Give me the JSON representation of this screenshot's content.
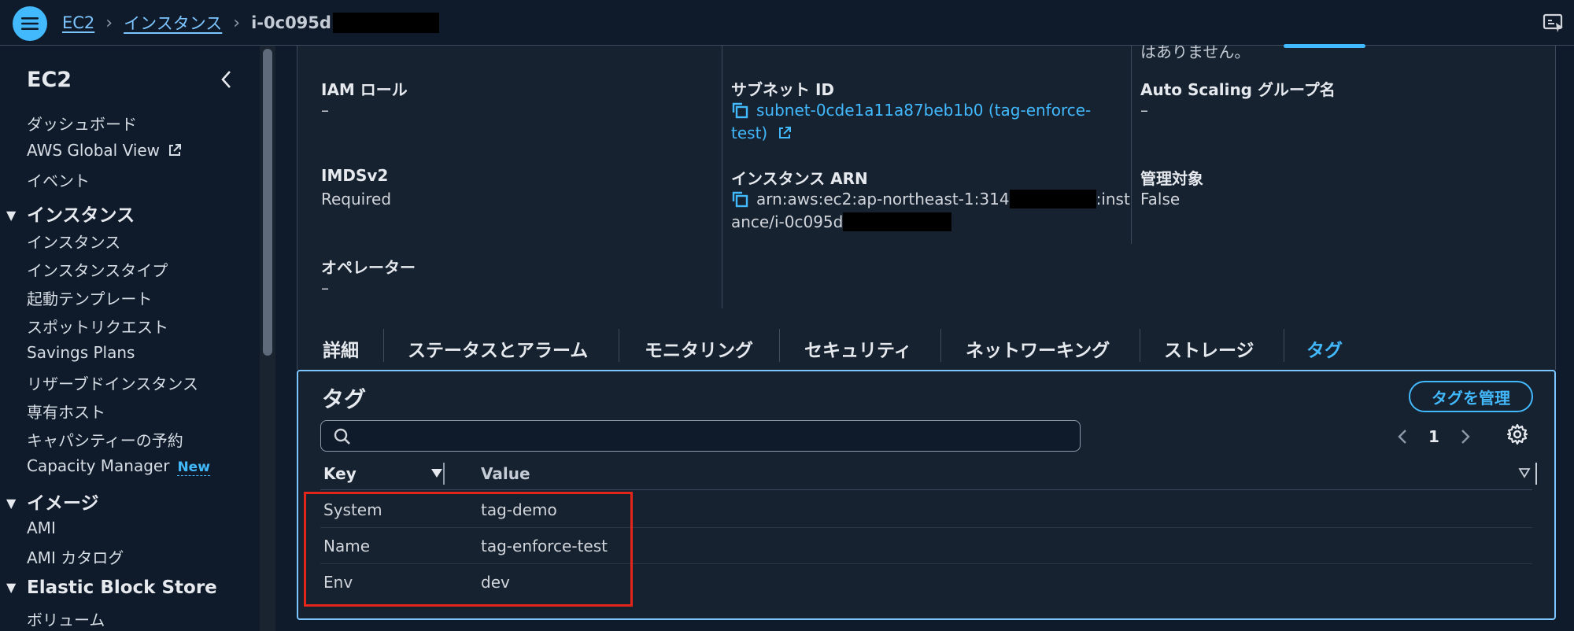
{
  "breadcrumb": {
    "items": [
      "EC2",
      "インスタンス"
    ],
    "current": "i-0c095d"
  },
  "sidebar": {
    "title": "EC2",
    "top_items": [
      "ダッシュボード",
      "AWS Global View",
      "イベント"
    ],
    "sections": [
      {
        "title": "インスタンス",
        "items": [
          "インスタンス",
          "インスタンスタイプ",
          "起動テンプレート",
          "スポットリクエスト",
          "Savings Plans",
          "リザーブドインスタンス",
          "専有ホスト",
          "キャパシティーの予約",
          "Capacity Manager"
        ]
      },
      {
        "title": "イメージ",
        "items": [
          "AMI",
          "AMI カタログ"
        ]
      },
      {
        "title": "Elastic Block Store",
        "items": [
          "ボリューム"
        ]
      }
    ],
    "new_badge": "New"
  },
  "details": {
    "clipped_text": "はありません。",
    "iam_role": {
      "label": "IAM ロール",
      "value": "–"
    },
    "imdsv2": {
      "label": "IMDSv2",
      "value": "Required"
    },
    "operator": {
      "label": "オペレーター",
      "value": "–"
    },
    "subnet": {
      "label": "サブネット ID",
      "line1": "subnet-0cde1a11a87beb1b0 (tag-enforce-",
      "line2": "test)"
    },
    "arn": {
      "label": "インスタンス ARN",
      "line1_a": "arn:aws:ec2:ap-northeast-1:314",
      "line1_b": ":inst",
      "line2": "ance/i-0c095d"
    },
    "asg": {
      "label": "Auto Scaling グループ名",
      "value": "–"
    },
    "managed": {
      "label": "管理対象",
      "value": "False"
    }
  },
  "tabs": [
    "詳細",
    "ステータスとアラーム",
    "モニタリング",
    "セキュリティ",
    "ネットワーキング",
    "ストレージ",
    "タグ"
  ],
  "active_tab": "タグ",
  "tags_panel": {
    "title": "タグ",
    "manage_label": "タグを管理",
    "search_placeholder": "",
    "page": "1",
    "columns": {
      "key": "Key",
      "value": "Value"
    },
    "rows": [
      {
        "key": "System",
        "value": "tag-demo"
      },
      {
        "key": "Name",
        "value": "tag-enforce-test"
      },
      {
        "key": "Env",
        "value": "dev"
      }
    ]
  },
  "colors": {
    "accent": "#42b8fd",
    "background": "#0f1b2a",
    "panel": "#162230",
    "highlight": "#e3251a"
  }
}
